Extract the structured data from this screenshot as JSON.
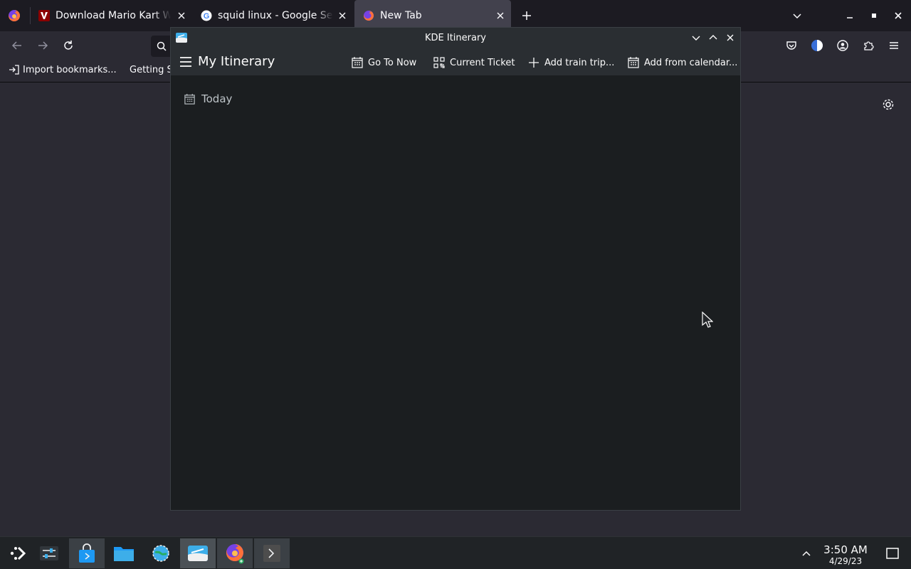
{
  "browser": {
    "tabs": [
      {
        "title": "Download Mario Kart Wii",
        "favicon": "vimm-icon",
        "selected": false
      },
      {
        "title": "squid linux - Google Search",
        "favicon": "google-icon",
        "selected": false
      },
      {
        "title": "New Tab",
        "favicon": "firefox-icon",
        "selected": true
      }
    ],
    "bookmarks": [
      {
        "label": "Import bookmarks...",
        "icon": "import-icon"
      },
      {
        "label": "Getting Started",
        "icon": "firefox-icon"
      }
    ]
  },
  "itinerary_window": {
    "title": "KDE Itinerary",
    "page_title": "My Itinerary",
    "toolbar": {
      "go_to_now": "Go To Now",
      "current_ticket": "Current Ticket",
      "add_train_trip": "Add train trip...",
      "add_from_calendar": "Add from calendar..."
    },
    "section_header": "Today"
  },
  "taskbar": {
    "time": "3:50 AM",
    "date": "4/29/23",
    "apps": [
      "application-launcher",
      "system-settings-mixer",
      "discover-store",
      "dolphin-file-manager",
      "system-settings",
      "kde-itinerary",
      "firefox",
      "konsole"
    ]
  },
  "colors": {
    "firefox_tabbar": "#1c1b22",
    "firefox_content": "#2b2a33",
    "kde_titlebar": "#2a2e32",
    "kde_window": "#1b1e20",
    "taskbar": "#202326",
    "accent": "#3daee9"
  }
}
